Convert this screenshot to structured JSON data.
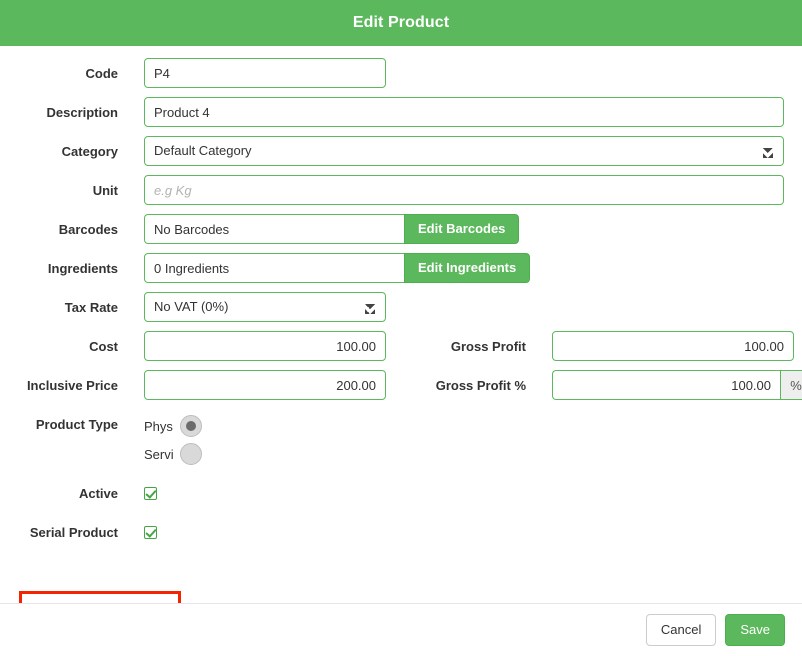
{
  "header": {
    "title": "Edit Product",
    "background": "#5cb85c",
    "text_color": "#ffffff"
  },
  "form": {
    "code": {
      "label": "Code",
      "value": "P4",
      "placeholder": ""
    },
    "description": {
      "label": "Description",
      "value": "Product 4",
      "placeholder": ""
    },
    "category": {
      "label": "Category",
      "value": "Default Category",
      "options": [
        "Default Category"
      ]
    },
    "unit": {
      "label": "Unit",
      "value": "",
      "placeholder": "e.g Kg"
    },
    "barcodes": {
      "label": "Barcodes",
      "value": "No Barcodes",
      "button_label": "Edit Barcodes"
    },
    "ingredients": {
      "label": "Ingredients",
      "value": "0 Ingredients",
      "button_label": "Edit Ingredients"
    },
    "tax_rate": {
      "label": "Tax Rate",
      "value": "No VAT (0%)",
      "options": [
        "No VAT (0%)"
      ]
    },
    "cost": {
      "label": "Cost",
      "value": "100.00"
    },
    "gross_profit": {
      "label": "Gross Profit",
      "value": "100.00"
    },
    "inclusive_price": {
      "label": "Inclusive Price",
      "value": "200.00"
    },
    "gross_profit_percent": {
      "label": "Gross Profit %",
      "value": "100.00",
      "addon": "%"
    },
    "product_type": {
      "label": "Product Type",
      "options": [
        {
          "label": "Physical",
          "visible_text": "Phys",
          "selected": true
        },
        {
          "label": "Service",
          "visible_text": "Servi",
          "selected": false
        }
      ]
    },
    "active": {
      "label": "Active",
      "checked": true
    },
    "serial_product": {
      "label": "Serial Product",
      "checked": true,
      "highlight_color": "#f42400"
    }
  },
  "footer": {
    "cancel_label": "Cancel",
    "save_label": "Save"
  }
}
